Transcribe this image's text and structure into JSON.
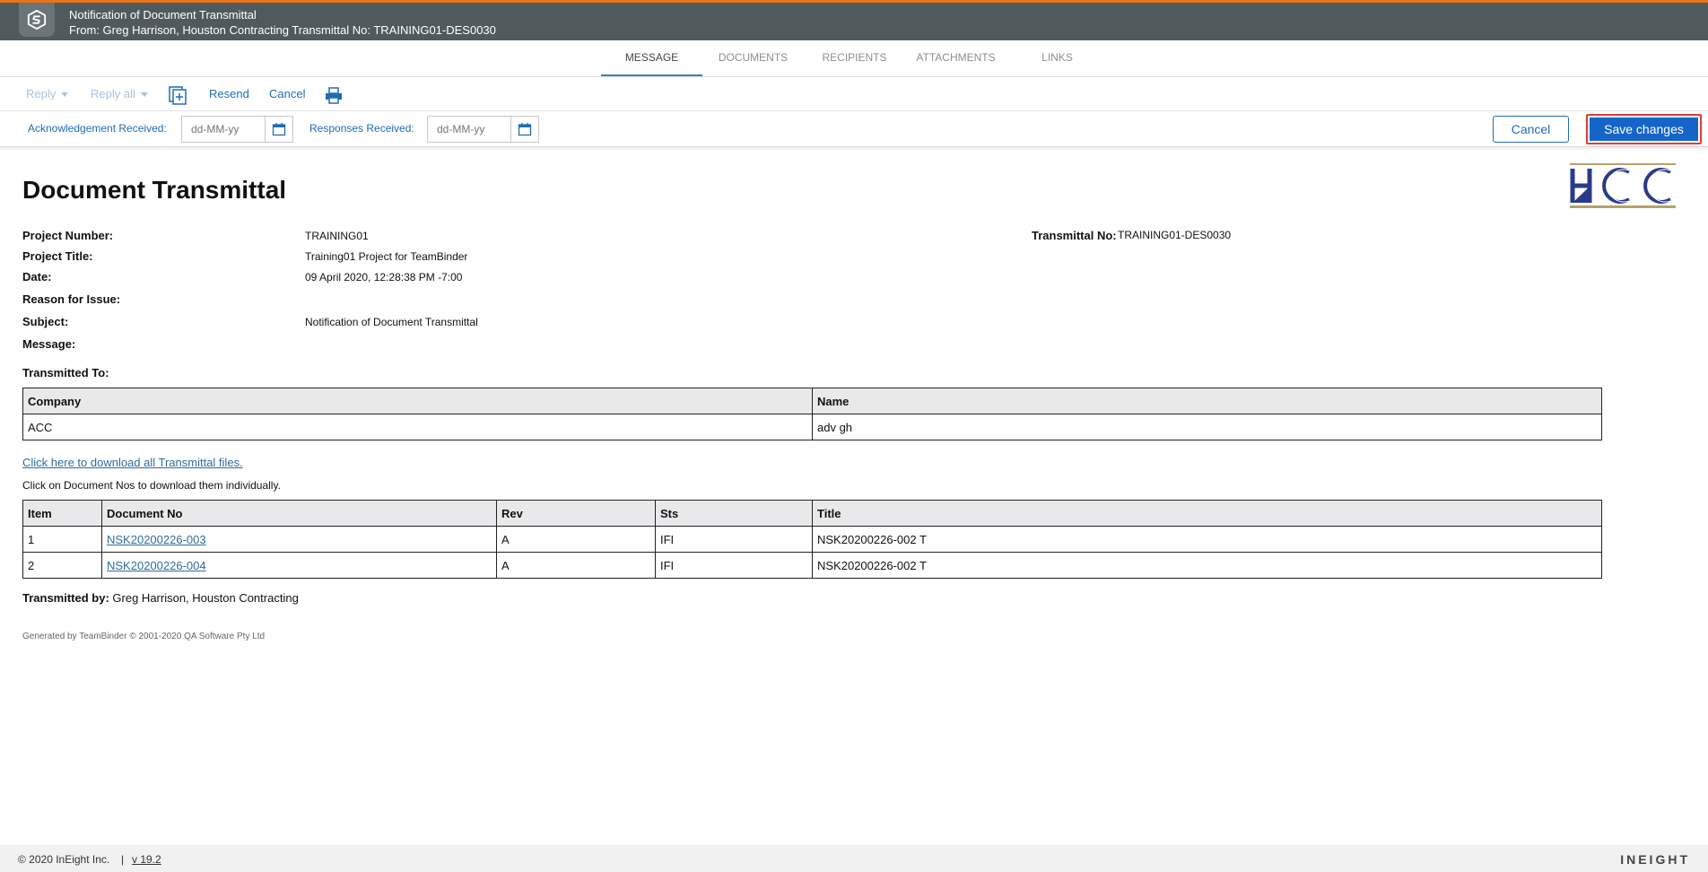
{
  "header": {
    "title": "Notification of Document Transmittal",
    "subtitle": "From: Greg Harrison, Houston Contracting Transmittal No: TRAINING01-DES0030",
    "accent_color": "#e8731a",
    "bar_color": "#505a5e"
  },
  "tabs": [
    {
      "label": "MESSAGE",
      "active": true
    },
    {
      "label": "DOCUMENTS",
      "active": false
    },
    {
      "label": "RECIPIENTS",
      "active": false
    },
    {
      "label": "ATTACHMENTS",
      "active": false
    },
    {
      "label": "LINKS",
      "active": false
    }
  ],
  "toolbar": {
    "reply_label": "Reply",
    "reply_all_label": "Reply all",
    "add_icon": "add-page-icon",
    "resend_label": "Resend",
    "cancel_label": "Cancel",
    "print_icon": "printer-icon"
  },
  "datebar": {
    "ack_label": "Acknowledgement Received:",
    "ack_placeholder": "dd-MM-yy",
    "resp_label": "Responses Received:",
    "resp_placeholder": "dd-MM-yy",
    "cancel_label": "Cancel",
    "save_label": "Save changes",
    "primary_color": "#1565c8",
    "highlight_color": "#e23b3b"
  },
  "document": {
    "title": "Document Transmittal",
    "logo_text": "HCC",
    "fields": {
      "project_number_label": "Project Number:",
      "project_number": "TRAINING01",
      "project_title_label": "Project Title:",
      "project_title": "Training01 Project for TeamBinder",
      "date_label": "Date:",
      "date": "09 April 2020, 12:28:38 PM -7:00",
      "reason_label": "Reason for Issue:",
      "subject_label": "Subject:",
      "subject": "Notification of Document Transmittal",
      "message_label": "Message:",
      "transmittal_no_label": "Transmittal No:",
      "transmittal_no": "TRAINING01-DES0030"
    },
    "transmitted_to_label": "Transmitted To:",
    "recipients_table": {
      "headers": [
        "Company",
        "Name"
      ],
      "rows": [
        [
          "ACC",
          "adv gh"
        ]
      ]
    },
    "download_all_link": "Click here to download all Transmittal files.",
    "download_note": "Click on Document Nos to download them individually.",
    "documents_table": {
      "headers": [
        "Item",
        "Document No",
        "Rev",
        "Sts",
        "Title"
      ],
      "rows": [
        [
          "1",
          "NSK20200226-003",
          "A",
          "IFI",
          "NSK20200226-002 T"
        ],
        [
          "2",
          "NSK20200226-004",
          "A",
          "IFI",
          "NSK20200226-002 T"
        ]
      ]
    },
    "transmitted_by_label": "Transmitted by:",
    "transmitted_by": "Greg Harrison, Houston Contracting",
    "generated_by": "Generated by TeamBinder © 2001-2020 QA Software Pty Ltd"
  },
  "footer": {
    "copyright": "© 2020 InEight Inc.",
    "separator": "|",
    "version": "v 19.2",
    "brand": "INEIGHT"
  }
}
